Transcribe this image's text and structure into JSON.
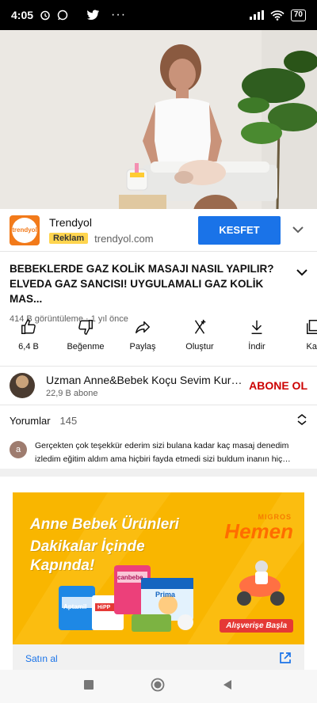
{
  "status_bar": {
    "time": "4:05",
    "battery": "70",
    "left_icons": [
      "alarm-icon",
      "whatsapp-icon",
      "twitter-icon",
      "more-icon"
    ],
    "right_icons": [
      "signal-icon",
      "wifi-icon",
      "battery-icon"
    ]
  },
  "ad": {
    "logo_text": "trendyol",
    "advertiser": "Trendyol",
    "badge": "Reklam",
    "domain": "trendyol.com",
    "cta_label": "KESFET",
    "accent": "#1a73e8"
  },
  "video": {
    "title": "BEBEKLERDE GAZ KOLİK MASAJI NASIL YAPILIR? ELVEDA GAZ SANCISI! UYGULAMALI GAZ KOLİK MAS...",
    "meta": "414 B görüntüleme · 1 yıl önce"
  },
  "actions": [
    {
      "label": "6,4 B",
      "icon": "like-icon"
    },
    {
      "label": "Beğenme",
      "icon": "dislike-icon"
    },
    {
      "label": "Paylaş",
      "icon": "share-icon"
    },
    {
      "label": "Oluştur",
      "icon": "create-icon"
    },
    {
      "label": "İndir",
      "icon": "download-icon"
    },
    {
      "label": "Kay",
      "icon": "save-icon"
    }
  ],
  "channel": {
    "name": "Uzman Anne&Bebek Koçu Sevim Kuruçay...",
    "subscribers": "22,9 B abone",
    "subscribe_label": "ABONE OL"
  },
  "comments": {
    "header": "Yorumlar",
    "count": "145",
    "avatar_letter": "a",
    "first_comment": "Gerçekten çok teşekkür ederim sizi bulana kadar kaç masaj denedim izledim eğitim aldım ama hiçbiri fayda etmedi sizi buldum inanın hiç umudum yokt..."
  },
  "banner": {
    "line1": "Anne Bebek Ürünleri",
    "line2": "Dakikalar İçinde",
    "line3": "Kapında!",
    "brand_small": "MIGROS",
    "brand_big": "Hemen",
    "cta": "Alışverişe Başla",
    "products": [
      "Aptamil",
      "canbebe",
      "HiPP",
      "Prima"
    ]
  },
  "buy": {
    "label": "Satın al"
  },
  "nav": {
    "icons": [
      "recents-icon",
      "home-icon",
      "back-icon"
    ]
  }
}
